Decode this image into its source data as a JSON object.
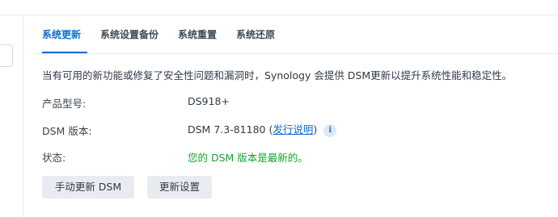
{
  "tabs": [
    {
      "label": "系统更新",
      "active": true
    },
    {
      "label": "系统设置备份",
      "active": false
    },
    {
      "label": "系统重置",
      "active": false
    },
    {
      "label": "系统还原",
      "active": false
    }
  ],
  "description": "当有可用的新功能或修复了安全性问题和漏洞时，Synology 会提供 DSM更新以提升系统性能和稳定性。",
  "info": {
    "model_label": "产品型号:",
    "model_value": "DS918+",
    "version_label": "DSM 版本:",
    "version_value": "DSM 7.3-81180",
    "version_paren_open": " (",
    "release_notes_link": "发行说明",
    "version_paren_close": ")",
    "info_icon": "info-icon",
    "status_label": "状态:",
    "status_value": "您的 DSM 版本是最新的。"
  },
  "buttons": {
    "manual_update": "手动更新 DSM",
    "update_settings": "更新设置"
  },
  "colors": {
    "accent": "#0b6fce",
    "status_ok": "#19a32d",
    "button_bg": "#e8ecf1"
  }
}
